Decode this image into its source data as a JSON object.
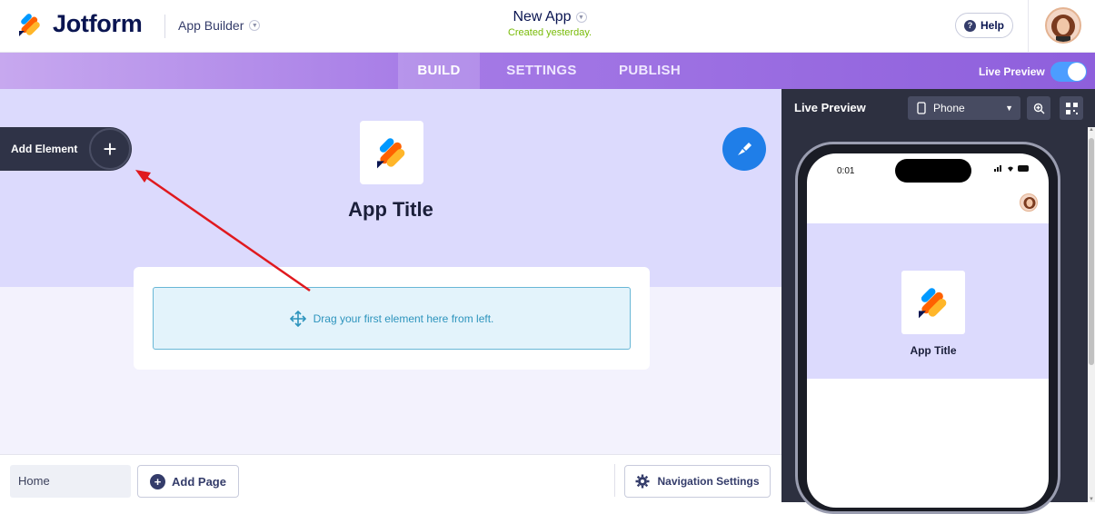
{
  "header": {
    "logo_text": "Jotform",
    "app_builder_label": "App Builder",
    "app_name": "New App",
    "app_subtitle": "Created yesterday.",
    "help_label": "Help"
  },
  "tabs": [
    {
      "label": "BUILD",
      "active": true
    },
    {
      "label": "SETTINGS",
      "active": false
    },
    {
      "label": "PUBLISH",
      "active": false
    }
  ],
  "live_preview_toggle": {
    "label": "Live Preview",
    "on": true
  },
  "builder": {
    "add_element_label": "Add Element",
    "app_title": "App Title",
    "drop_hint": "Drag your first element here from left."
  },
  "bottom": {
    "page_name": "Home",
    "add_page_label": "Add Page",
    "nav_settings_label": "Navigation Settings"
  },
  "preview": {
    "title": "Live Preview",
    "device": "Phone",
    "time": "0:01",
    "app_title": "App Title"
  },
  "colors": {
    "accent_purple": "#a57ae6",
    "toggle_blue": "#4c9dff",
    "brush_blue": "#1f7ee8",
    "arrow_red": "#e0191e"
  }
}
